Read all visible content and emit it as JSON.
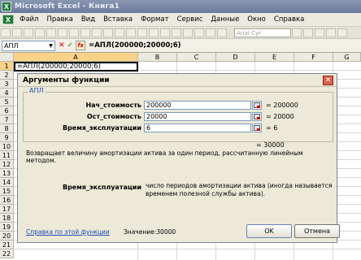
{
  "window": {
    "title": "Microsoft Excel - Книга1",
    "app_letter": "X"
  },
  "menu": [
    "Файл",
    "Правка",
    "Вид",
    "Вставка",
    "Формат",
    "Сервис",
    "Данные",
    "Окно",
    "Справка"
  ],
  "toolbar": {
    "font_box": "Arial Cyr"
  },
  "formula_bar": {
    "name_box": "АПЛ",
    "cancel_glyph": "✕",
    "enter_glyph": "✓",
    "fx_label": "fx",
    "formula": "=АПЛ(200000;20000;6)"
  },
  "sheet": {
    "columns": [
      "A",
      "B",
      "C",
      "D",
      "E",
      "F",
      "G"
    ],
    "rows": [
      "1",
      "2",
      "3",
      "4",
      "5",
      "6",
      "7",
      "8",
      "9",
      "10",
      "11",
      "12",
      "13",
      "14",
      "15",
      "16",
      "17",
      "18",
      "19",
      "20",
      "21",
      "22"
    ],
    "active_cell_text": "=АПЛ(200000;20000;6)"
  },
  "dialog": {
    "title": "Аргументы функции",
    "close_glyph": "✕",
    "group_label": "АПЛ",
    "args": [
      {
        "label": "Нач_стоимость",
        "value": "200000",
        "result": "= 200000"
      },
      {
        "label": "Ост_стоимость",
        "value": "20000",
        "result": "= 20000"
      },
      {
        "label": "Время_эксплуатации",
        "value": "6",
        "result": "= 6"
      }
    ],
    "summary_result": "= 30000",
    "description": "Возвращает величину амортизации актива за один период, рассчитанную линейным методом.",
    "param_name": "Время_эксплуатации",
    "param_desc": "число периодов амортизации актива (иногда называется временем полезной службы актива).",
    "help_link": "Справка по этой функции",
    "value_label": "Значение:30000",
    "ok_label": "OK",
    "cancel_label": "Отмена"
  }
}
